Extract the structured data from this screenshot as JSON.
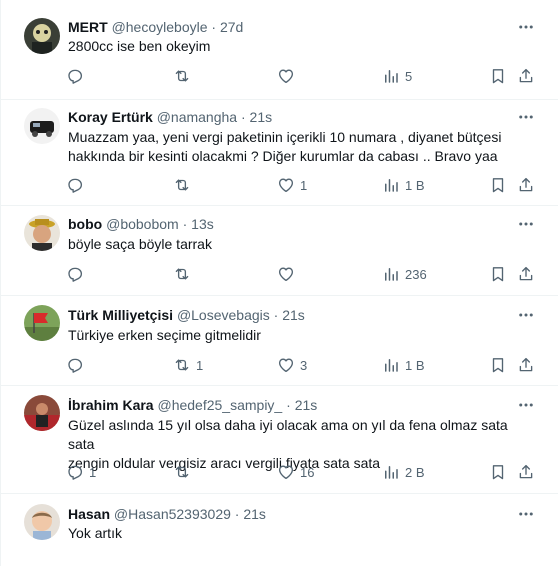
{
  "tweets": [
    {
      "name": "MERT",
      "handle": "@hecoyleboyle",
      "dot": "·",
      "time": "27d",
      "lines": [
        "2800cc ise ben okeyim"
      ],
      "reply_count": "",
      "retweet_count": "",
      "like_count": "",
      "views": "5"
    },
    {
      "name": "Koray Ertürk",
      "handle": "@namangha",
      "dot": "·",
      "time": "21s",
      "lines": [
        "Muazzam yaa, yeni vergi paketinin içerikli 10 numara , diyanet bütçesi",
        "hakkında bir kesinti olacakmi ? Diğer kurumlar da cabası .. Bravo yaa"
      ],
      "reply_count": "",
      "retweet_count": "",
      "like_count": "1",
      "views": "1 B"
    },
    {
      "name": "bobo",
      "handle": "@bobobom",
      "dot": "·",
      "time": "13s",
      "lines": [
        "böyle saça böyle tarrak"
      ],
      "reply_count": "",
      "retweet_count": "",
      "like_count": "",
      "views": "236"
    },
    {
      "name": "Türk Milliyetçisi",
      "handle": "@Losevebagis",
      "dot": "·",
      "time": "21s",
      "lines": [
        "Türkiye erken seçime gitmelidir"
      ],
      "reply_count": "",
      "retweet_count": "1",
      "like_count": "3",
      "views": "1 B"
    },
    {
      "name": "İbrahim Kara",
      "handle": "@hedef25_sampiy_",
      "dot": "·",
      "time": "21s",
      "lines": [
        "Güzel aslında 15 yıl olsa daha iyi olacak ama on yıl da fena olmaz sata sata",
        "zengin oldular vergisiz aracı vergili fiyata sata sata"
      ],
      "reply_count": "1",
      "retweet_count": "",
      "like_count": "16",
      "views": "2 B"
    },
    {
      "name": "Hasan",
      "handle": "@Hasan52393029",
      "dot": "·",
      "time": "21s",
      "lines": [
        "Yok artık"
      ],
      "reply_count": "",
      "retweet_count": "",
      "like_count": "",
      "views": ""
    }
  ],
  "icons": {
    "reply": "reply-icon",
    "retweet": "retweet-icon",
    "like": "heart-icon",
    "views": "views-chart-icon",
    "bookmark": "bookmark-icon",
    "share": "share-icon",
    "more": "more-dots-icon"
  },
  "colors": {
    "text": "#0f1419",
    "muted": "#536471",
    "divider": "#eff3f4"
  }
}
